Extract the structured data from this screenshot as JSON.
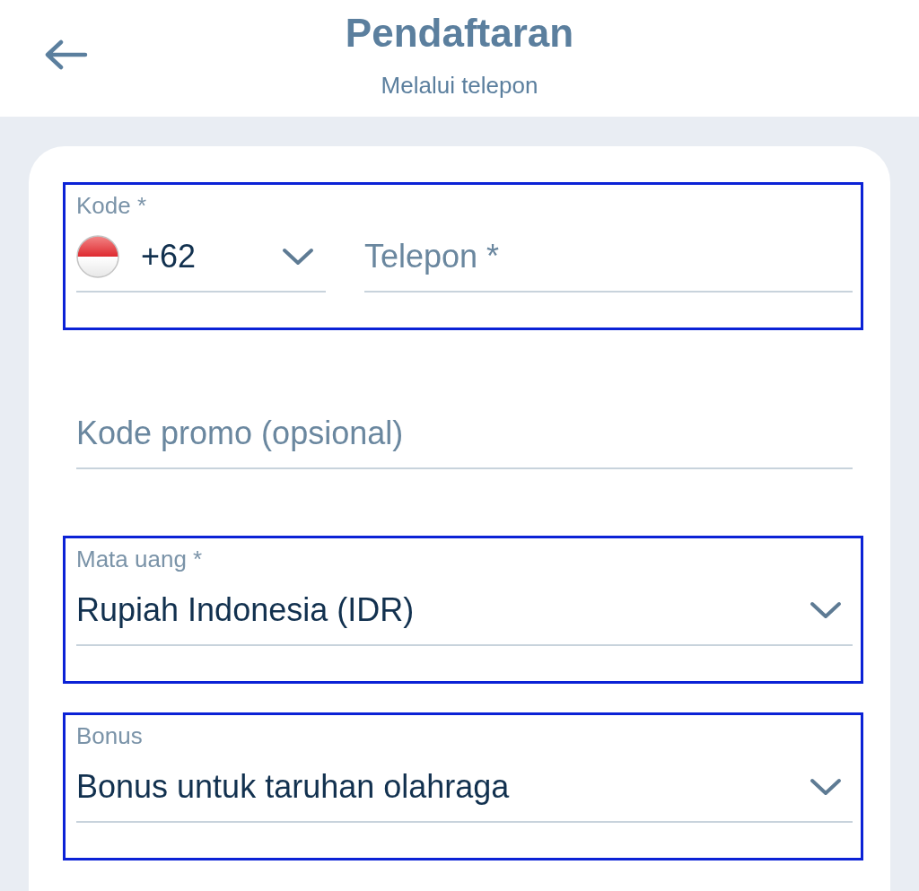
{
  "header": {
    "title": "Pendaftaran",
    "subtitle": "Melalui telepon"
  },
  "fields": [
    {
      "kind": "phone",
      "highlighted": true,
      "code": {
        "label": "Kode *",
        "value": "+62"
      },
      "phone": {
        "placeholder": "Telepon *"
      }
    },
    {
      "kind": "text",
      "highlighted": false,
      "placeholder": "Kode promo (opsional)"
    },
    {
      "kind": "select",
      "highlighted": true,
      "label": "Mata uang *",
      "value": "Rupiah Indonesia (IDR)"
    },
    {
      "kind": "select",
      "highlighted": true,
      "label": "Bonus",
      "value": "Bonus untuk taruhan olahraga"
    }
  ]
}
